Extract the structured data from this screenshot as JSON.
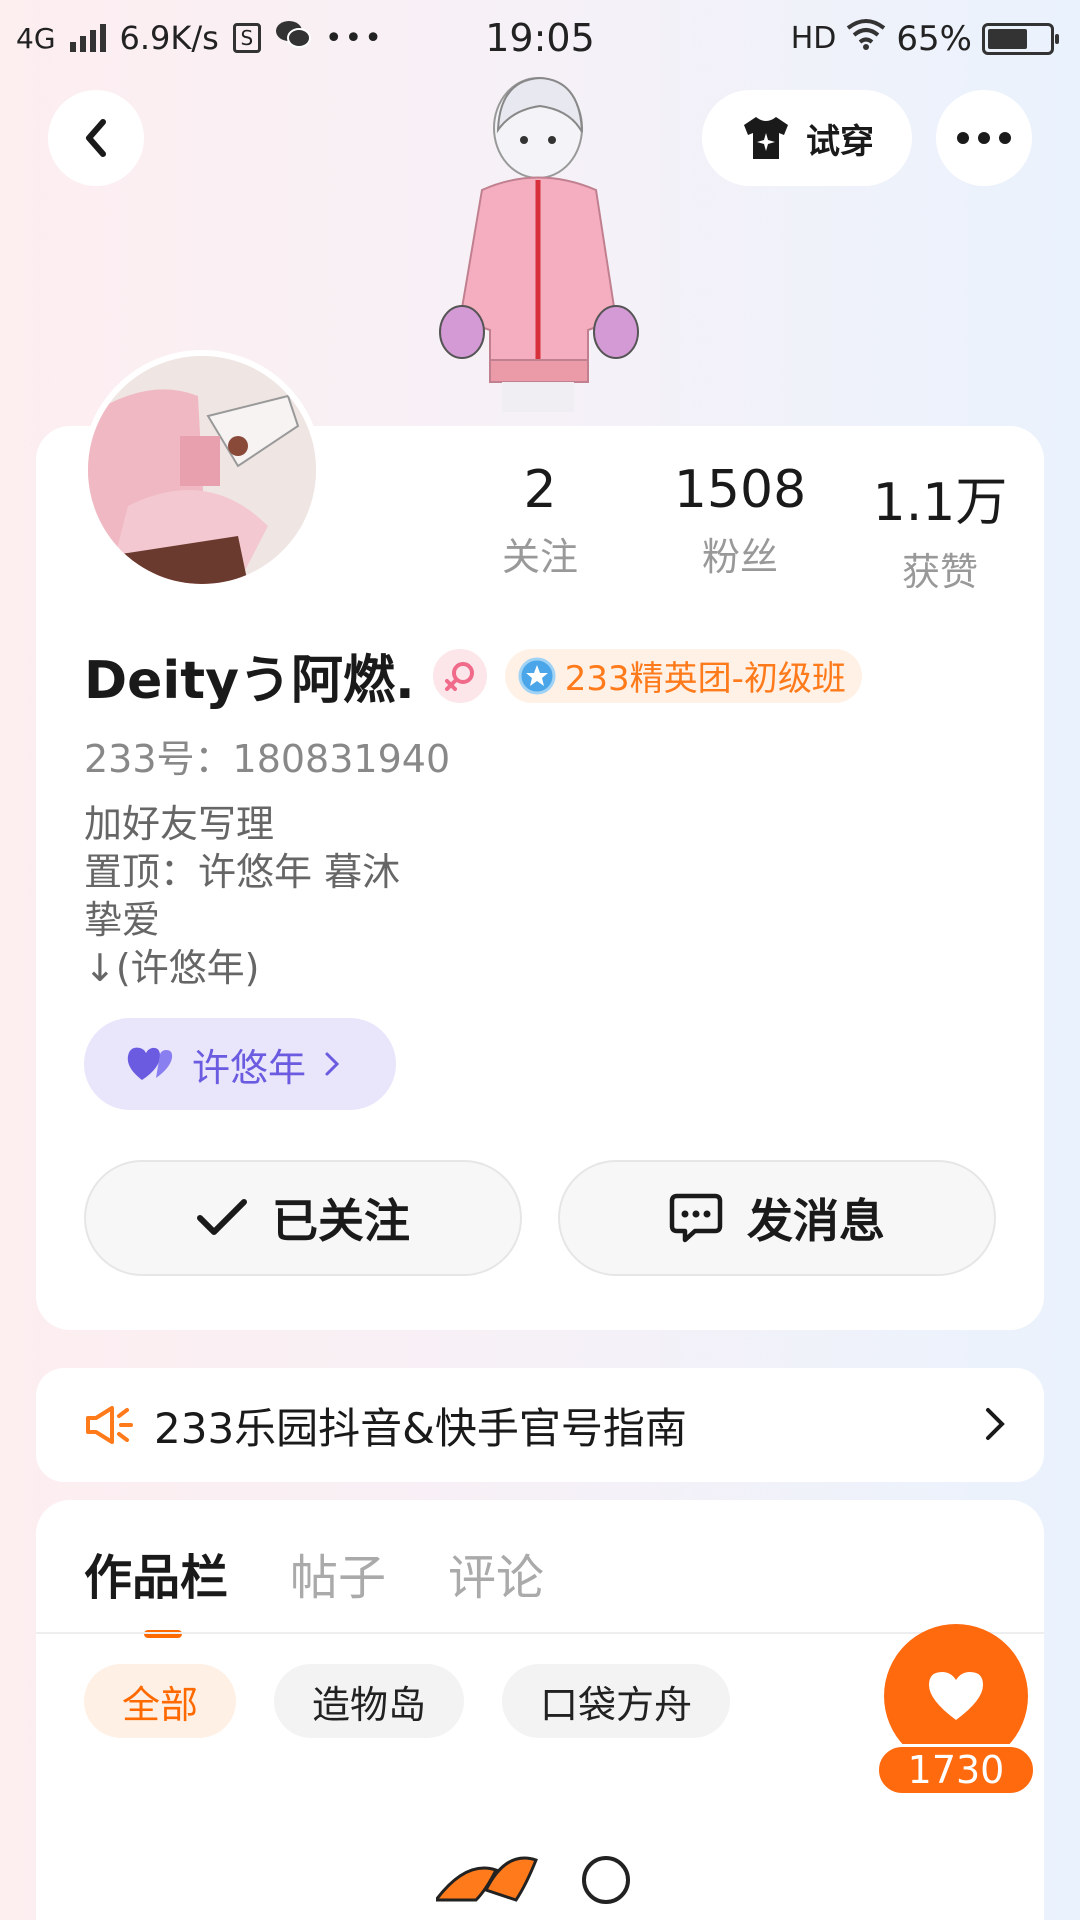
{
  "status_bar": {
    "network": "4G",
    "speed": "6.9K/s",
    "time": "19:05",
    "hd": "HD",
    "battery": "65%",
    "battery_level": 0.65
  },
  "header": {
    "try_on_label": "试穿"
  },
  "profile": {
    "stats": [
      {
        "value": "2",
        "label": "关注"
      },
      {
        "value": "1508",
        "label": "粉丝"
      },
      {
        "value": "1.1万",
        "label": "获赞"
      }
    ],
    "name": "Deityう阿燃.",
    "badge": "233精英团-初级班",
    "uid": "233号：180831940",
    "bio": [
      "加好友写理",
      "置顶：许悠年 暮沐",
      "挚爱",
      "↓(许悠年)"
    ],
    "cp_name": "许悠年",
    "follow_label": "已关注",
    "message_label": "发消息"
  },
  "notice": {
    "text": "233乐园抖音&快手官号指南"
  },
  "works": {
    "tabs": [
      "作品栏",
      "帖子",
      "评论"
    ],
    "filters": [
      "全部",
      "造物岛",
      "口袋方舟"
    ]
  },
  "like": {
    "count": "1730"
  },
  "colors": {
    "accent": "#ff6a00",
    "cp_purple": "#6a5be0",
    "badge_orange": "#ff7a1a"
  }
}
